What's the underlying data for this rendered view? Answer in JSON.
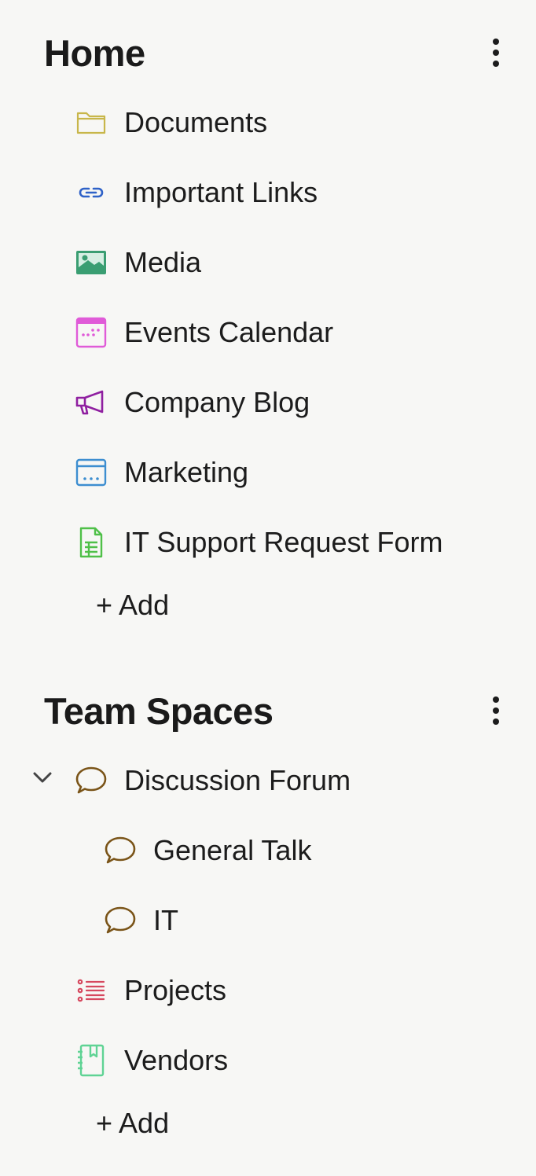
{
  "home": {
    "title": "Home",
    "items": [
      {
        "label": "Documents",
        "icon": "folder-icon",
        "color": "#c8b64a"
      },
      {
        "label": "Important Links",
        "icon": "link-icon",
        "color": "#2f62c8"
      },
      {
        "label": "Media",
        "icon": "image-icon",
        "color": "#3a9e72"
      },
      {
        "label": "Events Calendar",
        "icon": "calendar-icon",
        "color": "#e05bd8"
      },
      {
        "label": "Company Blog",
        "icon": "megaphone-icon",
        "color": "#8f1fa0"
      },
      {
        "label": "Marketing",
        "icon": "browser-window-icon",
        "color": "#3d8ed0"
      },
      {
        "label": "IT Support Request Form",
        "icon": "form-icon",
        "color": "#4fc048"
      }
    ],
    "add_label": "+ Add"
  },
  "team_spaces": {
    "title": "Team Spaces",
    "items": [
      {
        "label": "Discussion Forum",
        "icon": "speech-bubble-icon",
        "color": "#7a5418",
        "expanded": true
      },
      {
        "label": "General Talk",
        "icon": "speech-bubble-icon",
        "color": "#7a5418"
      },
      {
        "label": "IT",
        "icon": "speech-bubble-icon",
        "color": "#7a5418"
      },
      {
        "label": "Projects",
        "icon": "checklist-icon",
        "color": "#d6485e"
      },
      {
        "label": "Vendors",
        "icon": "address-book-icon",
        "color": "#5fd394"
      }
    ],
    "add_label": "+ Add"
  }
}
